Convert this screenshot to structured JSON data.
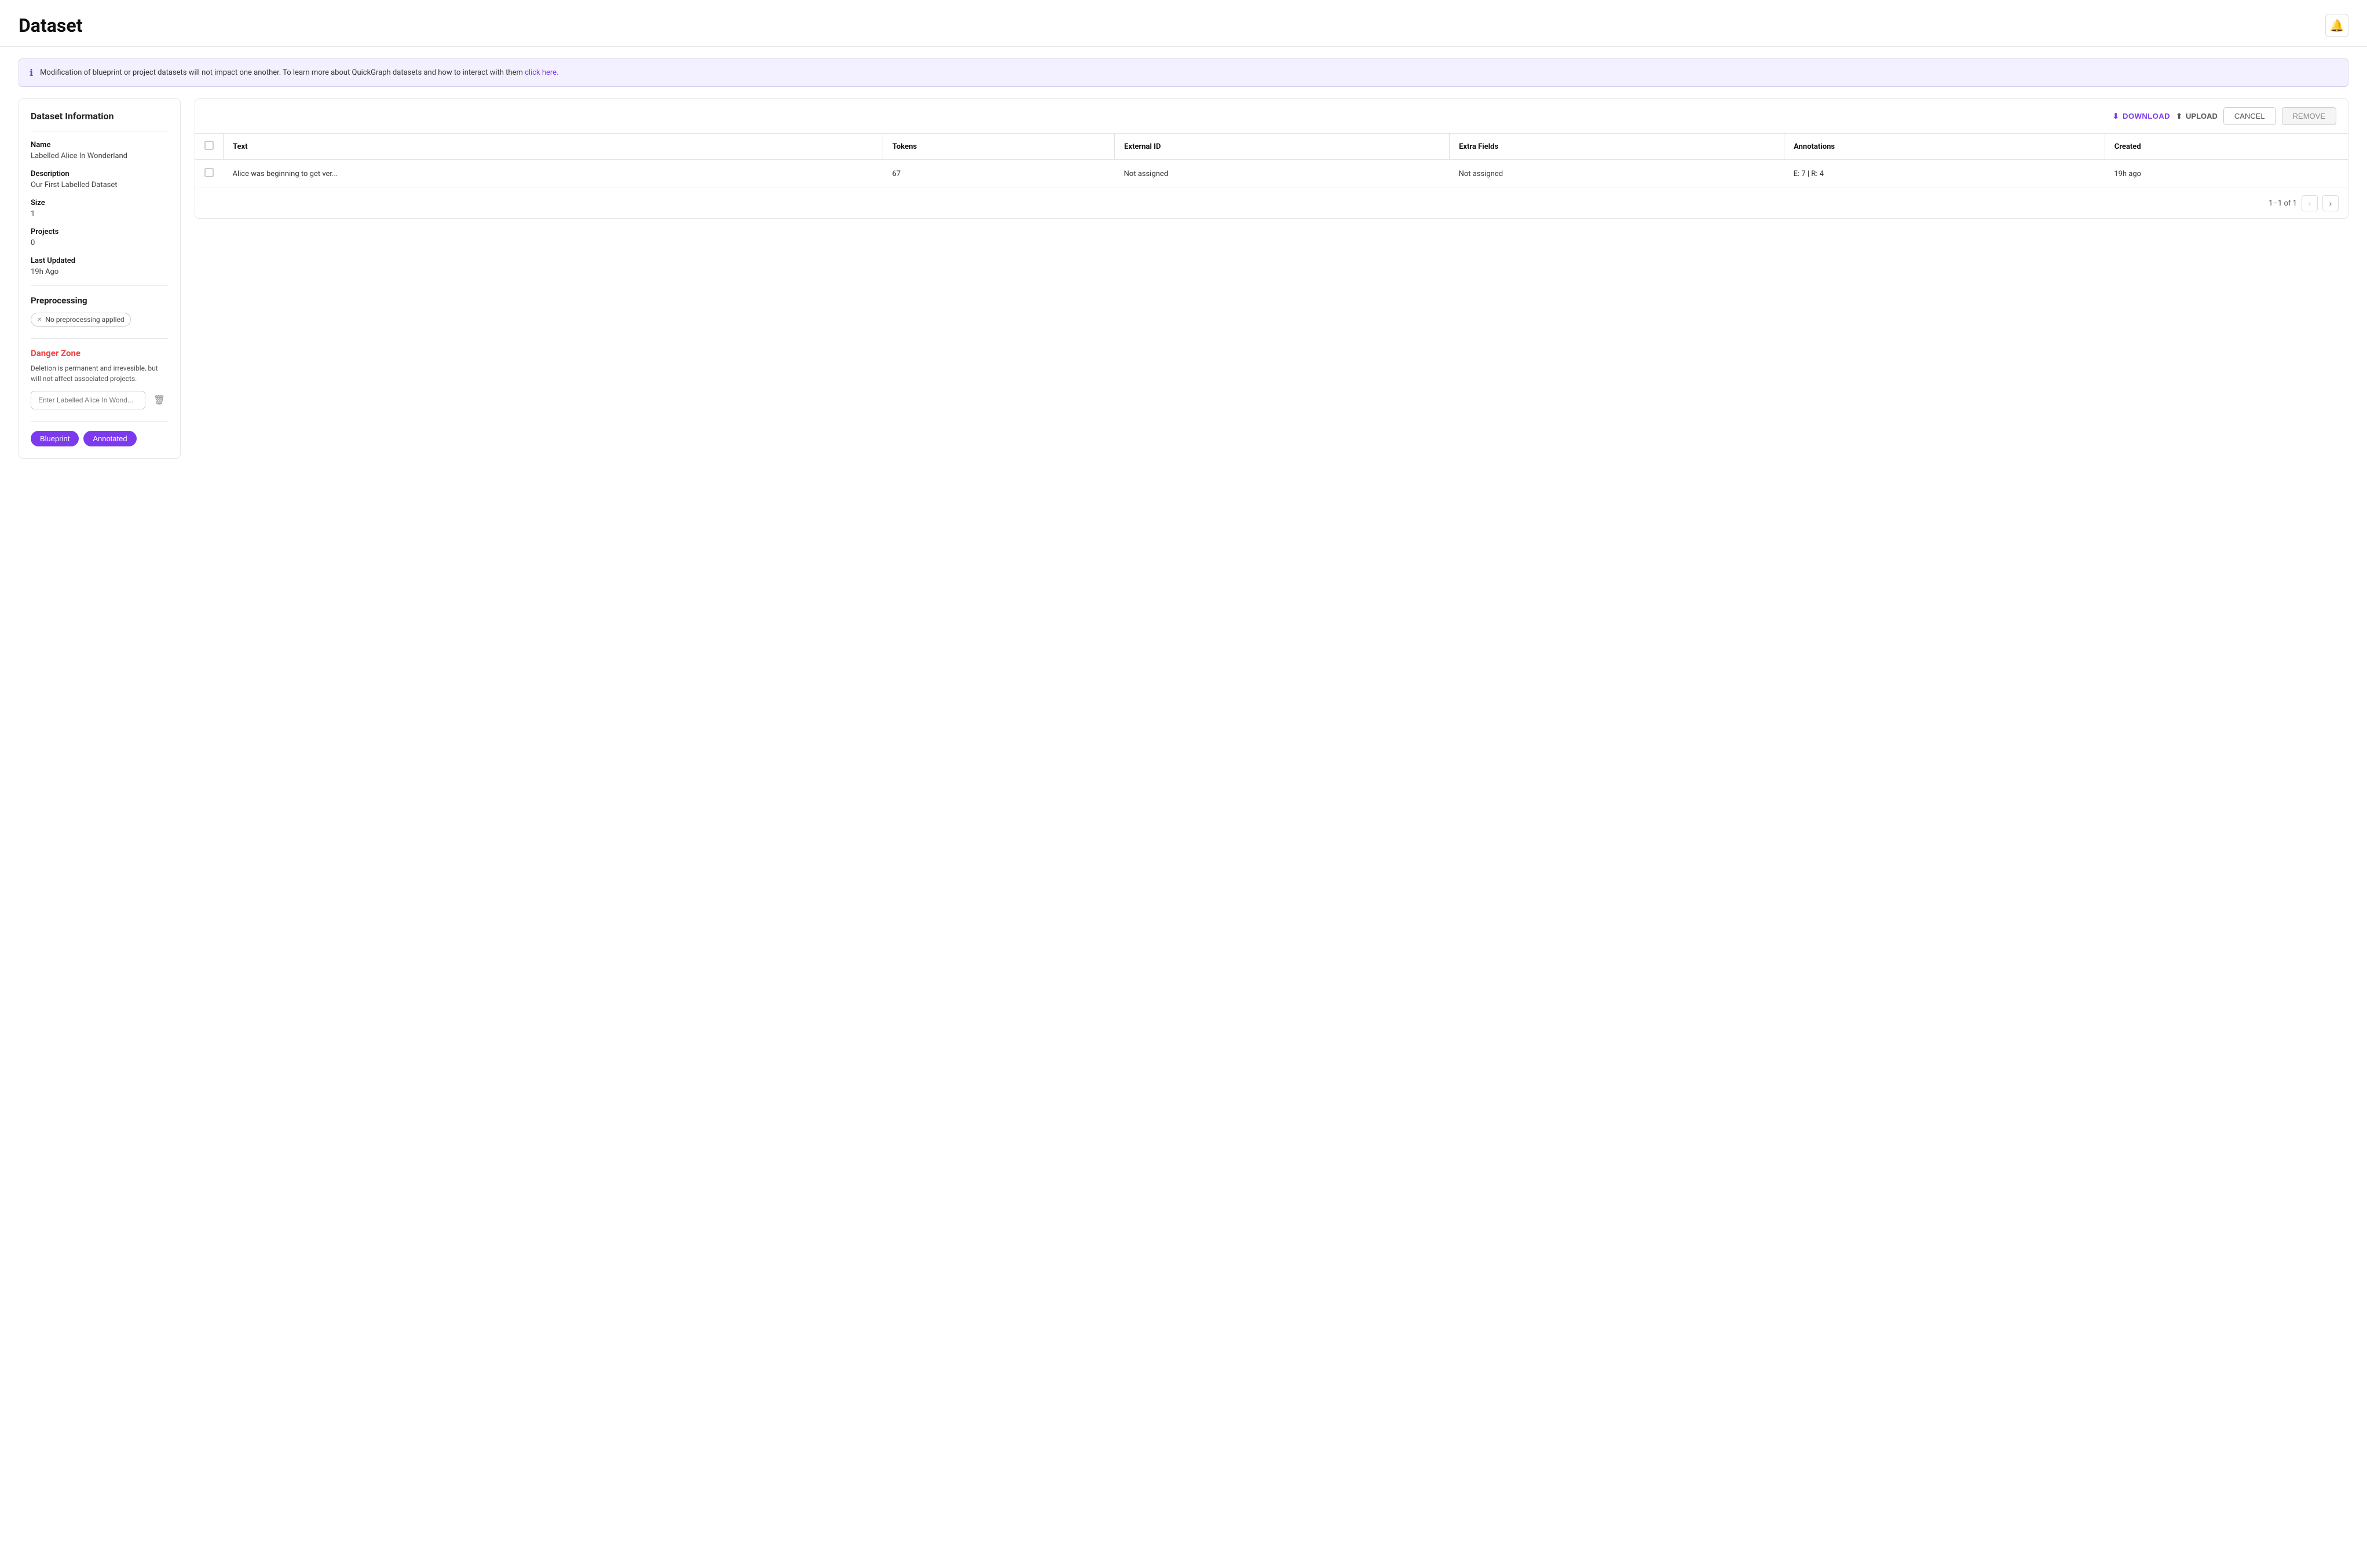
{
  "page": {
    "title": "Dataset"
  },
  "banner": {
    "text": "Modification of blueprint or project datasets will not impact one another. To learn more about QuickGraph datasets and how to interact with them ",
    "link_text": "click here.",
    "link_href": "#"
  },
  "sidebar": {
    "panel_title": "Dataset Information",
    "fields": [
      {
        "label": "Name",
        "value": "Labelled Alice In Wonderland"
      },
      {
        "label": "Description",
        "value": "Our First Labelled Dataset"
      },
      {
        "label": "Size",
        "value": "1"
      },
      {
        "label": "Projects",
        "value": "0"
      },
      {
        "label": "Last Updated",
        "value": "19h Ago"
      }
    ],
    "preprocessing_title": "Preprocessing",
    "preprocessing_tag": "No preprocessing applied",
    "danger_zone": {
      "title": "Danger Zone",
      "description": "Deletion is permanent and irrevesible, but will not affect associated projects.",
      "input_placeholder": "Enter Labelled Alice In Wond..."
    },
    "tabs": [
      {
        "label": "Blueprint",
        "active": true
      },
      {
        "label": "Annotated",
        "active": true
      }
    ]
  },
  "toolbar": {
    "download_label": "DOWNLOAD",
    "upload_label": "UPLOAD",
    "cancel_label": "CANCEL",
    "remove_label": "REMOVE"
  },
  "table": {
    "columns": [
      {
        "label": "Text"
      },
      {
        "label": "Tokens"
      },
      {
        "label": "External ID"
      },
      {
        "label": "Extra Fields"
      },
      {
        "label": "Annotations"
      },
      {
        "label": "Created"
      }
    ],
    "rows": [
      {
        "text": "Alice was beginning to get ver...",
        "tokens": "67",
        "external_id": "Not assigned",
        "extra_fields": "Not assigned",
        "annotations": "E: 7 | R: 4",
        "created": "19h ago"
      }
    ],
    "pagination": {
      "label": "1–1 of 1"
    }
  },
  "icons": {
    "bell": "🔔",
    "info": "ℹ",
    "download": "⬇",
    "upload": "⬆",
    "trash": "🗑",
    "close": "✕",
    "chevron_left": "‹",
    "chevron_right": "›"
  }
}
